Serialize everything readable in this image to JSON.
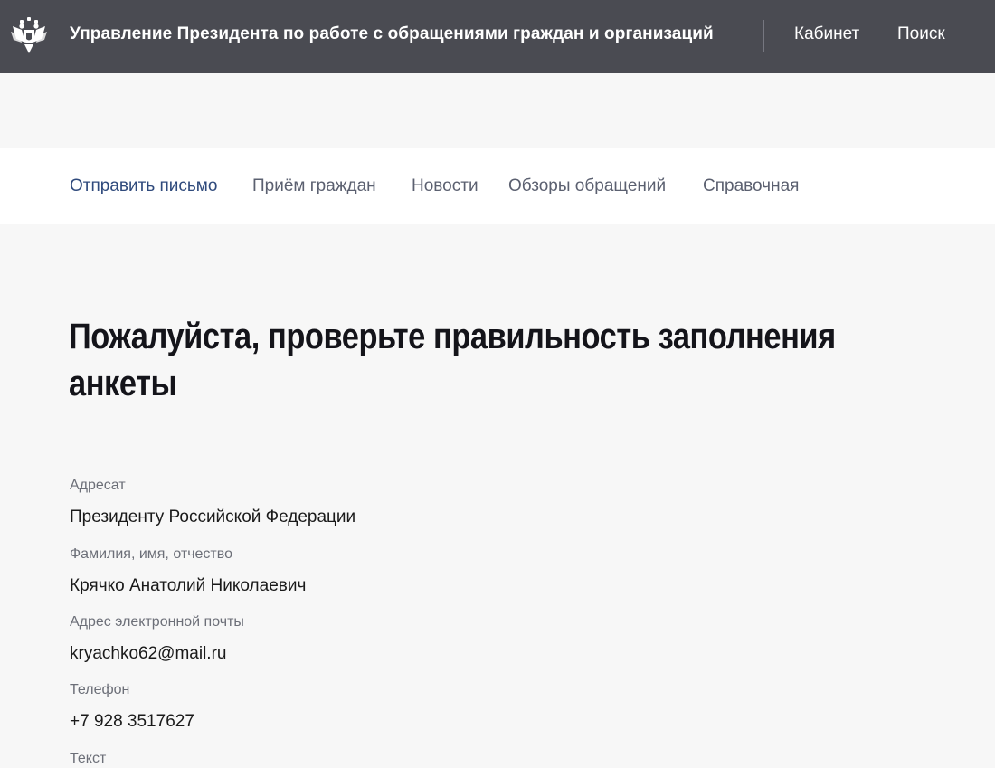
{
  "header": {
    "title": "Управление Президента по работе с обращениями граждан и организаций",
    "cabinet_label": "Кабинет",
    "search_label": "Поиск",
    "background_color": "#4a4b52",
    "emblem_icon": "double-headed-eagle-icon"
  },
  "nav": {
    "items": [
      {
        "label": "Отправить письмо",
        "active": true
      },
      {
        "label": "Приём граждан",
        "active": false
      },
      {
        "label": "Новости",
        "active": false
      },
      {
        "label": "Обзоры обращений",
        "active": false
      },
      {
        "label": "Справочная",
        "active": false
      }
    ],
    "active_color": "#2f4a7c"
  },
  "main": {
    "title": "Пожалуйста, проверьте правильность заполнения анкеты",
    "fields": [
      {
        "label": "Адресат",
        "value": "Президенту Российской Федерации"
      },
      {
        "label": "Фамилия, имя, отчество",
        "value": "Крячко Анатолий Николаевич"
      },
      {
        "label": "Адрес электронной почты",
        "value": "kryachko62@mail.ru"
      },
      {
        "label": "Телефон",
        "value": "+7 928 3517627"
      },
      {
        "label": "Текст",
        "value": ""
      }
    ]
  }
}
